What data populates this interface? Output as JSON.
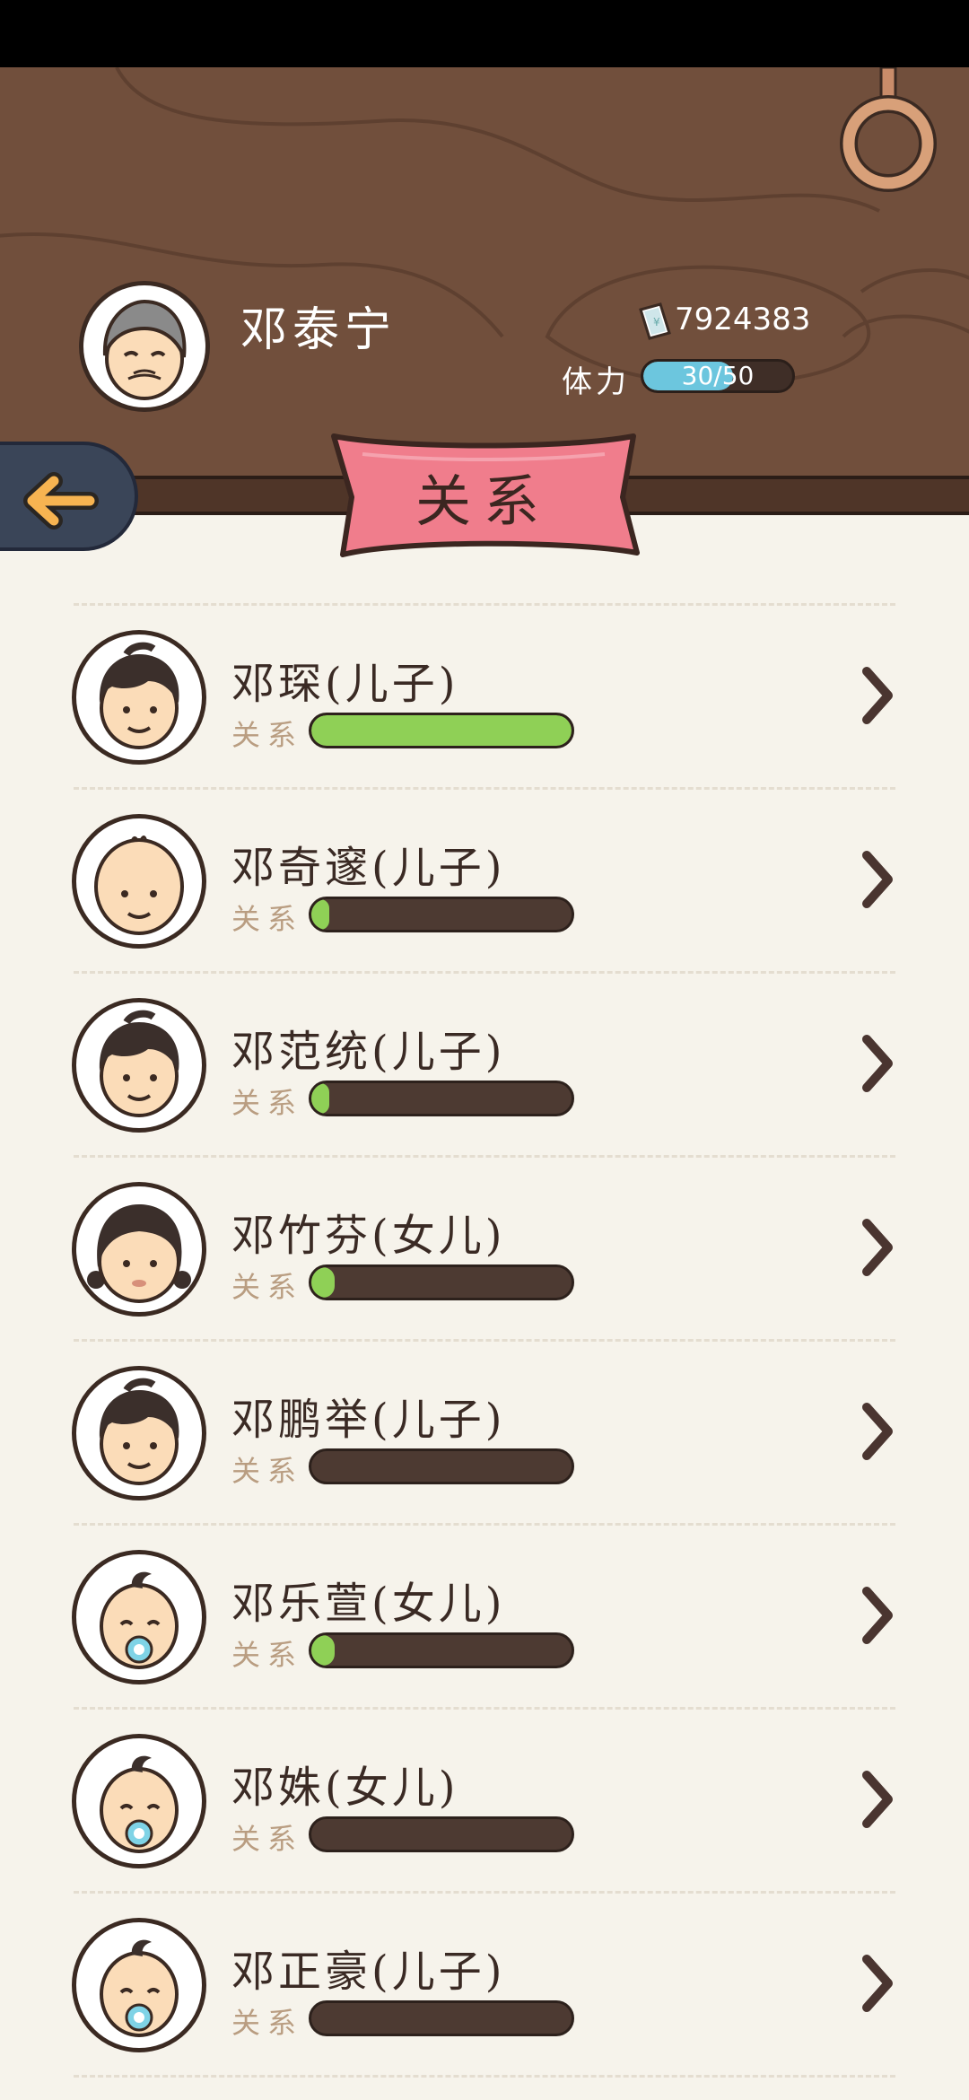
{
  "header": {
    "player_name": "邓泰宁",
    "money": "7924383",
    "stamina_label": "体力",
    "stamina_text": "30/50",
    "stamina_fraction": 0.6,
    "title": "关系",
    "back_icon": "back-arrow-icon",
    "money_icon": "banknote-icon"
  },
  "colors": {
    "wood": "#714f3c",
    "paper": "#f6f3eb",
    "ribbon": "#f07d8c",
    "bar_green": "#8fd056",
    "bar_dark": "#4d3a32",
    "stamina_blue": "#6cc6de"
  },
  "relations": {
    "label": "关系",
    "items": [
      {
        "name": "邓琛(儿子)",
        "level": 1.0,
        "avatar": "boy-hair"
      },
      {
        "name": "邓奇邃(儿子)",
        "level": 0.04,
        "avatar": "bald"
      },
      {
        "name": "邓范统(儿子)",
        "level": 0.03,
        "avatar": "boy-hair"
      },
      {
        "name": "邓竹芬(女儿)",
        "level": 0.09,
        "avatar": "girl"
      },
      {
        "name": "邓鹏举(儿子)",
        "level": 0.0,
        "avatar": "boy-hair"
      },
      {
        "name": "邓乐萱(女儿)",
        "level": 0.09,
        "avatar": "baby"
      },
      {
        "name": "邓姝(女儿)",
        "level": 0.0,
        "avatar": "baby"
      },
      {
        "name": "邓正豪(儿子)",
        "level": 0.0,
        "avatar": "baby"
      }
    ]
  }
}
